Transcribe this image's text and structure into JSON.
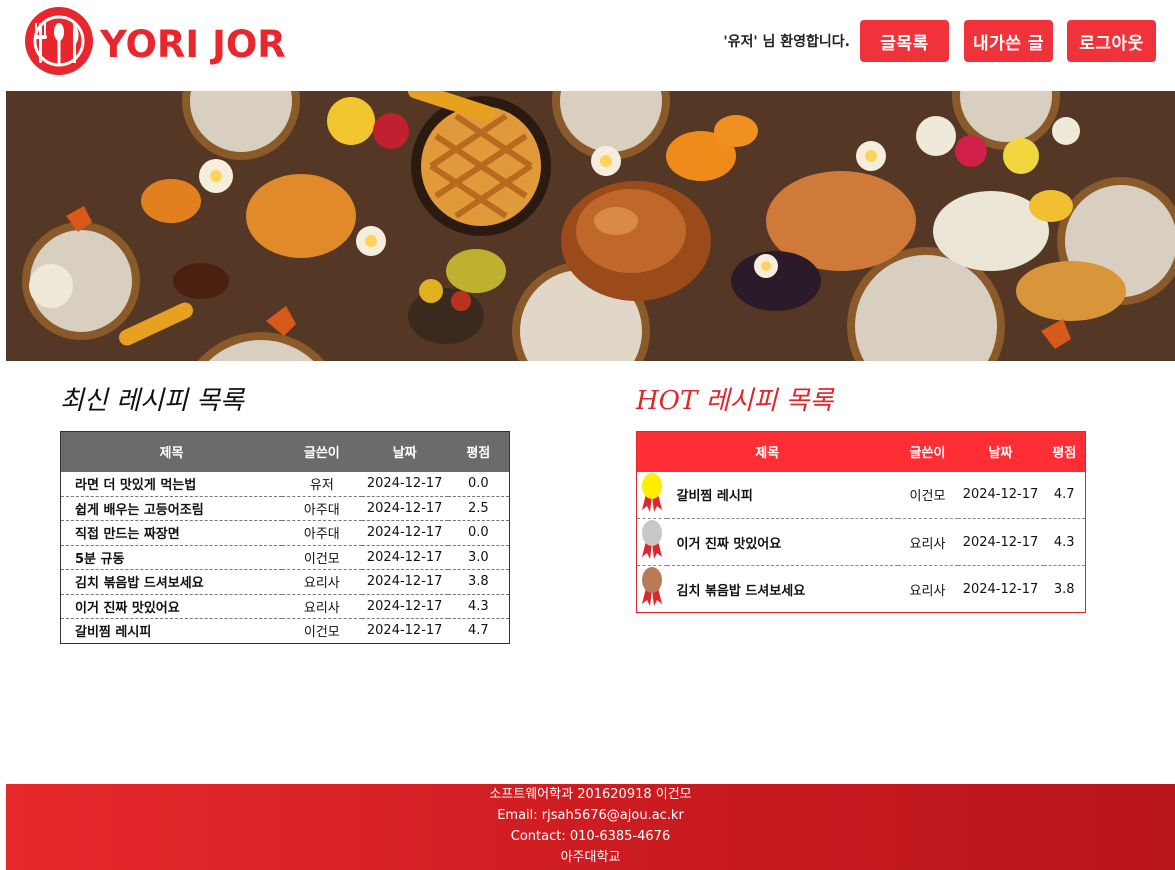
{
  "header": {
    "logo_text": "YORI JORI",
    "welcome": "'유저' 님 환영합니다.",
    "buttons": {
      "list": "글목록",
      "mine": "내가쓴 글",
      "logout": "로그아웃"
    }
  },
  "colors": {
    "accent": "#f0333b",
    "hot_header": "#ff2d34",
    "latest_header": "#6b6b6b",
    "footer": "#d11e24"
  },
  "latest": {
    "title": "최신 레시피 목록",
    "columns": [
      "제목",
      "글쓴이",
      "날짜",
      "평점"
    ],
    "rows": [
      {
        "title": "라면 더 맛있게 먹는법",
        "author": "유저",
        "date": "2024-12-17",
        "rating": "0.0"
      },
      {
        "title": "쉽게 배우는 고등어조림",
        "author": "아주대",
        "date": "2024-12-17",
        "rating": "2.5"
      },
      {
        "title": "직접 만드는 짜장면",
        "author": "아주대",
        "date": "2024-12-17",
        "rating": "0.0"
      },
      {
        "title": "5분 규동",
        "author": "이건모",
        "date": "2024-12-17",
        "rating": "3.0"
      },
      {
        "title": "김치 볶음밥 드셔보세요",
        "author": "요리사",
        "date": "2024-12-17",
        "rating": "3.8"
      },
      {
        "title": "이거 진짜 맛있어요",
        "author": "요리사",
        "date": "2024-12-17",
        "rating": "4.3"
      },
      {
        "title": "갈비찜 레시피",
        "author": "이건모",
        "date": "2024-12-17",
        "rating": "4.7"
      }
    ]
  },
  "hot": {
    "title": "HOT 레시피 목록",
    "columns": [
      "제목",
      "글쓴이",
      "날짜",
      "평점"
    ],
    "rows": [
      {
        "medal": "gold-medal-icon",
        "medal_color": "#ffee00",
        "title": "갈비찜 레시피",
        "author": "이건모",
        "date": "2024-12-17",
        "rating": "4.7"
      },
      {
        "medal": "silver-medal-icon",
        "medal_color": "#c8c8c8",
        "title": "이거 진짜 맛있어요",
        "author": "요리사",
        "date": "2024-12-17",
        "rating": "4.3"
      },
      {
        "medal": "bronze-medal-icon",
        "medal_color": "#b97a57",
        "title": "김치 볶음밥 드셔보세요",
        "author": "요리사",
        "date": "2024-12-17",
        "rating": "3.8"
      }
    ]
  },
  "footer": {
    "line1": "소프트웨어학과 201620918 이건모",
    "line2": "Email: rjsah5676@ajou.ac.kr",
    "line3": "Contact: 010-6385-4676",
    "line4": "아주대학교"
  }
}
